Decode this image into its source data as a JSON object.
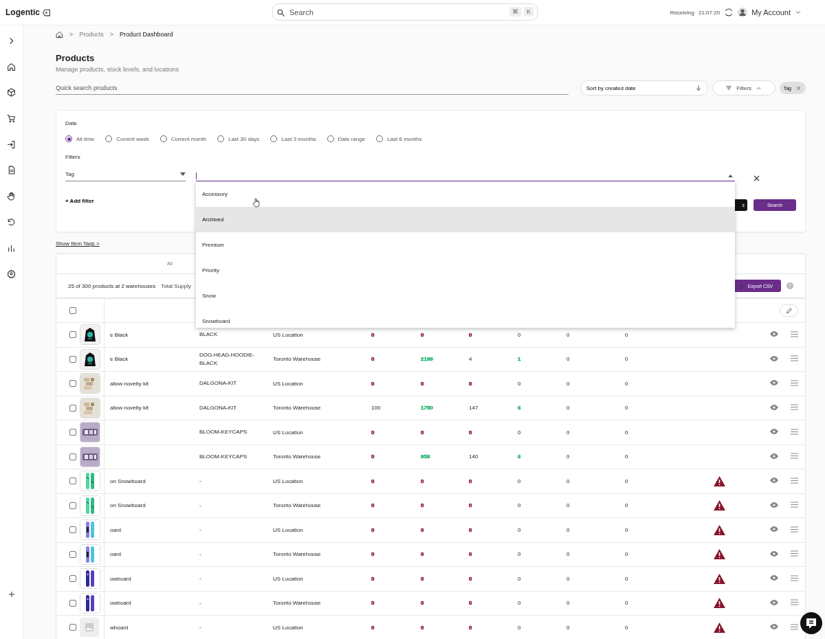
{
  "topbar": {
    "logo": "Logentic",
    "search_placeholder": "Search",
    "shortcut_keys": [
      "⌘",
      "K"
    ],
    "receiving_label": "Receiving",
    "receiving_time": "21:07:20",
    "account": "My Account"
  },
  "breadcrumb": [
    {
      "separator": ">",
      "label": "Products"
    },
    {
      "separator": ">",
      "label": "Product Dashboard"
    }
  ],
  "page": {
    "title": "Products",
    "subtitle": "Manage products, stock levels, and locations"
  },
  "toolbar": {
    "quick_search_placeholder": "Quick search products",
    "sort": "Sort by created date",
    "filters_button": "Filters",
    "chips": [
      "Tag"
    ]
  },
  "filter_panel": {
    "date_label": "Date",
    "date_options": [
      {
        "label": "All time",
        "selected": true
      },
      {
        "label": "Current week",
        "selected": false
      },
      {
        "label": "Current month",
        "selected": false
      },
      {
        "label": "Last 30 days",
        "selected": false
      },
      {
        "label": "Last 3 months",
        "selected": false
      },
      {
        "label": "Date range",
        "selected": false
      },
      {
        "label": "Last 6 months",
        "selected": false
      }
    ],
    "filters_label": "Filters",
    "field_select": "Tag",
    "add_filter": "+ Add filter",
    "hidden_button": "s",
    "search_button": "Search",
    "dropdown": [
      {
        "label": "Accessory",
        "highlighted": false
      },
      {
        "label": "Archived",
        "highlighted": true
      },
      {
        "label": "Premium",
        "highlighted": false
      },
      {
        "label": "Priority",
        "highlighted": false
      },
      {
        "label": "Snow",
        "highlighted": false
      },
      {
        "label": "Snowboard",
        "highlighted": false
      }
    ]
  },
  "show_tags_link": "Show Item Tags >",
  "tabs": [
    {
      "label": "All",
      "selected": true
    }
  ],
  "summary": {
    "count": "25 of 300 products at 2 warehouses",
    "total": "Total Supply",
    "export": "Export CSV"
  },
  "select_all_checked": false,
  "rows": [
    {
      "kind": "picture",
      "checked": false,
      "name": "e Black",
      "sku": "BLACK",
      "location": "US Location",
      "values": [
        {
          "text": "0",
          "color": "#8a1530"
        },
        {
          "text": "0",
          "color": "#8a1530"
        },
        {
          "text": "0",
          "color": "#8a1530"
        },
        {
          "text": "0"
        },
        {
          "text": "0"
        },
        {
          "text": "0"
        }
      ],
      "warning": false
    },
    {
      "kind": "picture",
      "checked": false,
      "name": "e Black",
      "sku": "DOG-HEAD-HOODIE-BLACK",
      "location": "Toronto Warehouse",
      "values": [
        {
          "text": "0",
          "color": "#8a1530"
        },
        {
          "text": "2199",
          "color": "#2bb673"
        },
        {
          "text": "4"
        },
        {
          "text": "1",
          "color": "#2bb673"
        },
        {
          "text": "0"
        },
        {
          "text": "0"
        }
      ],
      "warning": false
    },
    {
      "kind": "picture",
      "checked": false,
      "name": "allow novelty kit",
      "sku": "DALGONA-KIT",
      "location": "US Location",
      "values": [
        {
          "text": "0",
          "color": "#8a1530"
        },
        {
          "text": "0",
          "color": "#8a1530"
        },
        {
          "text": "0",
          "color": "#8a1530"
        },
        {
          "text": "0"
        },
        {
          "text": "0"
        },
        {
          "text": "0"
        }
      ],
      "warning": false
    },
    {
      "kind": "picture",
      "checked": false,
      "name": "allow novelty kit",
      "sku": "DALGONA-KIT",
      "location": "Toronto Warehouse",
      "values": [
        {
          "text": "100"
        },
        {
          "text": "1750",
          "color": "#2bb673"
        },
        {
          "text": "147"
        },
        {
          "text": "6",
          "color": "#2bb673"
        },
        {
          "text": "0"
        },
        {
          "text": "0"
        }
      ],
      "warning": false
    },
    {
      "kind": "picture",
      "checked": false,
      "sku": "BLOOM-KEYCAPS",
      "location": "US Location",
      "values": [
        {
          "text": "0",
          "color": "#8a1530"
        },
        {
          "text": "0",
          "color": "#8a1530"
        },
        {
          "text": "0",
          "color": "#8a1530"
        },
        {
          "text": "0"
        },
        {
          "text": "0"
        },
        {
          "text": "0"
        }
      ],
      "warning": false
    },
    {
      "kind": "picture",
      "checked": false,
      "sku": "BLOOM-KEYCAPS",
      "location": "Toronto Warehouse",
      "values": [
        {
          "text": "0",
          "color": "#8a1530"
        },
        {
          "text": "958",
          "color": "#2bb673"
        },
        {
          "text": "140"
        },
        {
          "text": "6",
          "color": "#2bb673"
        },
        {
          "text": "0"
        },
        {
          "text": "0"
        }
      ],
      "warning": false
    },
    {
      "kind": "picture",
      "checked": false,
      "name": "on Snowboard",
      "sku": "-",
      "location": "US Location",
      "values": [
        {
          "text": "0",
          "color": "#8a1530"
        },
        {
          "text": "0",
          "color": "#8a1530"
        },
        {
          "text": "0",
          "color": "#8a1530"
        },
        {
          "text": "0"
        },
        {
          "text": "0"
        },
        {
          "text": "0"
        }
      ],
      "warning": true
    },
    {
      "kind": "picture",
      "checked": false,
      "name": "on Snowboard",
      "sku": "-",
      "location": "Toronto Warehouse",
      "values": [
        {
          "text": "0",
          "color": "#8a1530"
        },
        {
          "text": "0",
          "color": "#8a1530"
        },
        {
          "text": "0",
          "color": "#8a1530"
        },
        {
          "text": "0"
        },
        {
          "text": "0"
        },
        {
          "text": "0"
        }
      ],
      "warning": true
    },
    {
      "kind": "picture",
      "checked": false,
      "name": "oard",
      "sku": "-",
      "location": "US Location",
      "values": [
        {
          "text": "0",
          "color": "#8a1530"
        },
        {
          "text": "0",
          "color": "#8a1530"
        },
        {
          "text": "0",
          "color": "#8a1530"
        },
        {
          "text": "0"
        },
        {
          "text": "0"
        },
        {
          "text": "0"
        }
      ],
      "warning": true
    },
    {
      "kind": "picture",
      "checked": false,
      "name": "oard",
      "sku": "-",
      "location": "Toronto Warehouse",
      "values": [
        {
          "text": "0",
          "color": "#8a1530"
        },
        {
          "text": "0",
          "color": "#8a1530"
        },
        {
          "text": "0",
          "color": "#8a1530"
        },
        {
          "text": "0"
        },
        {
          "text": "0"
        },
        {
          "text": "0"
        }
      ],
      "warning": true
    },
    {
      "kind": "picture",
      "checked": false,
      "name": "owboard",
      "sku": "-",
      "location": "US Location",
      "values": [
        {
          "text": "0",
          "color": "#8a1530"
        },
        {
          "text": "0",
          "color": "#8a1530"
        },
        {
          "text": "0",
          "color": "#8a1530"
        },
        {
          "text": "0"
        },
        {
          "text": "0"
        },
        {
          "text": "0"
        }
      ],
      "warning": true
    },
    {
      "kind": "picture",
      "checked": false,
      "name": "owboard",
      "sku": "-",
      "location": "Toronto Warehouse",
      "values": [
        {
          "text": "0",
          "color": "#8a1530"
        },
        {
          "text": "0",
          "color": "#8a1530"
        },
        {
          "text": "0",
          "color": "#8a1530"
        },
        {
          "text": "0"
        },
        {
          "text": "0"
        },
        {
          "text": "0"
        }
      ],
      "warning": true
    },
    {
      "kind": "placeholder",
      "checked": false,
      "name": "wboard",
      "sku": "-",
      "location": "US Location",
      "values": [
        {
          "text": "0",
          "color": "#8a1530"
        },
        {
          "text": "0",
          "color": "#8a1530"
        },
        {
          "text": "0",
          "color": "#8a1530"
        },
        {
          "text": "0"
        },
        {
          "text": "0"
        },
        {
          "text": "0"
        }
      ],
      "warning": true
    }
  ]
}
